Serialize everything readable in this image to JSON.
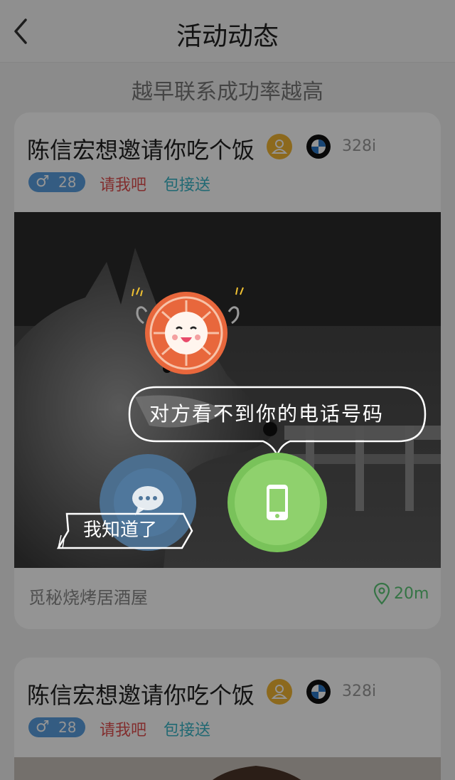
{
  "nav": {
    "title": "活动动态",
    "back_icon": "chevron-left-icon"
  },
  "subtitle": "越早联系成功率越高",
  "cards": [
    {
      "title": "陈信宏想邀请你吃个饭",
      "car_model": "328i",
      "gender_symbol": "♂",
      "age": "28",
      "tag_pay": "请我吧",
      "tag_ride": "包接送",
      "venue": "觅秘烧烤居酒屋",
      "distance": "20m"
    },
    {
      "title": "陈信宏想邀请你吃个饭",
      "car_model": "328i",
      "gender_symbol": "♂",
      "age": "28",
      "tag_pay": "请我吧",
      "tag_ride": "包接送"
    }
  ],
  "guide": {
    "bubble_text": "对方看不到你的电话号码",
    "dismiss_label": "我知道了"
  },
  "colors": {
    "accent_green": "#8fd16d",
    "tag_blue": "#5b9fe0",
    "tag_red": "#e05050",
    "tag_teal": "#3ab5c6",
    "badge_yellow": "#f1b533",
    "mascot_orange": "#e8673c"
  }
}
